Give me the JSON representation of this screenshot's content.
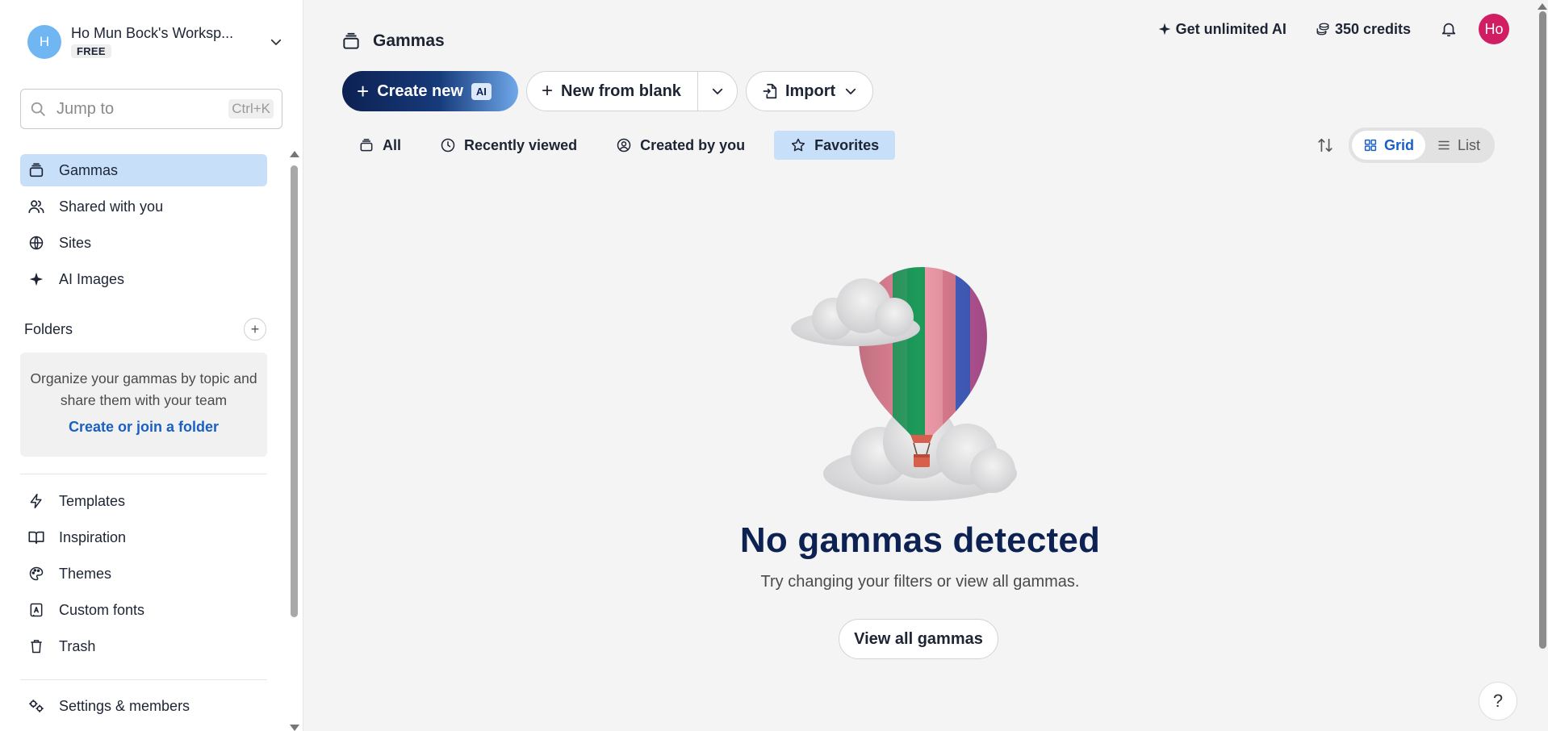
{
  "workspace": {
    "avatar_letter": "H",
    "name": "Ho Mun Bock's Worksp...",
    "plan": "FREE"
  },
  "search": {
    "placeholder": "Jump to",
    "shortcut": "Ctrl+K"
  },
  "sidebar": {
    "nav": [
      {
        "label": "Gammas",
        "icon": "stack-icon",
        "active": true
      },
      {
        "label": "Shared with you",
        "icon": "users-icon"
      },
      {
        "label": "Sites",
        "icon": "globe-icon"
      },
      {
        "label": "AI Images",
        "icon": "sparkle-icon"
      }
    ],
    "folders_heading": "Folders",
    "folders_desc": "Organize your gammas by topic and share them with your team",
    "folders_link": "Create or join a folder",
    "secondary": [
      {
        "label": "Templates",
        "icon": "bolt-icon"
      },
      {
        "label": "Inspiration",
        "icon": "book-icon"
      },
      {
        "label": "Themes",
        "icon": "palette-icon"
      },
      {
        "label": "Custom fonts",
        "icon": "font-icon"
      },
      {
        "label": "Trash",
        "icon": "trash-icon"
      }
    ],
    "settings": "Settings & members"
  },
  "header": {
    "title": "Gammas",
    "unlimited_ai": "Get unlimited AI",
    "credits": "350 credits",
    "user_initials": "Ho"
  },
  "actions": {
    "create_new": "Create new",
    "ai_badge": "AI",
    "new_from_blank": "New from blank",
    "import": "Import"
  },
  "tabs": [
    {
      "label": "All"
    },
    {
      "label": "Recently viewed"
    },
    {
      "label": "Created by you"
    },
    {
      "label": "Favorites",
      "active": true
    }
  ],
  "view": {
    "grid": "Grid",
    "list": "List",
    "selected": "Grid"
  },
  "empty_state": {
    "title": "No gammas detected",
    "subtitle": "Try changing your filters or view all gammas.",
    "button": "View all gammas"
  },
  "help": "?",
  "colors": {
    "accent": "#1a5fc4",
    "active_bg": "#c8dffa",
    "navy": "#0d2152",
    "user_avatar": "#d11e63",
    "workspace_avatar": "#6fb6f2"
  }
}
